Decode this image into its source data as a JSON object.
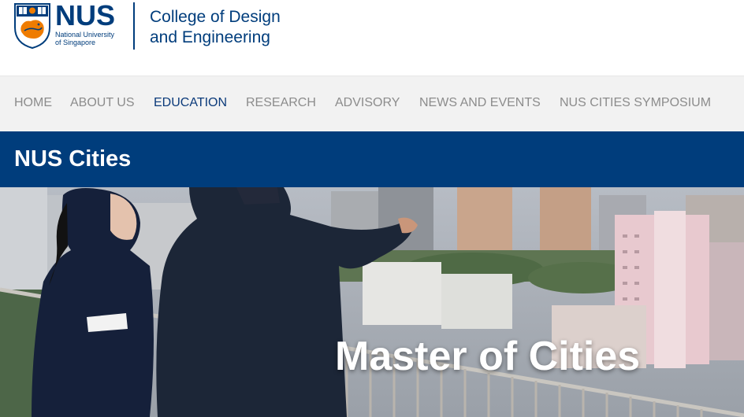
{
  "header": {
    "logo_wordmark": "NUS",
    "logo_subtext_line1": "National University",
    "logo_subtext_line2": "of Singapore",
    "college_line1": "College of Design",
    "college_line2": "and Engineering"
  },
  "nav": {
    "items": [
      {
        "label": "HOME",
        "active": false
      },
      {
        "label": "ABOUT US",
        "active": false
      },
      {
        "label": "EDUCATION",
        "active": true
      },
      {
        "label": "RESEARCH",
        "active": false
      },
      {
        "label": "ADVISORY",
        "active": false
      },
      {
        "label": "NEWS AND EVENTS",
        "active": false
      },
      {
        "label": "NUS CITIES SYMPOSIUM",
        "active": false
      }
    ]
  },
  "banner": {
    "title": "NUS Cities"
  },
  "hero": {
    "title": "Master of Cities",
    "image_icon": "hero-photo"
  },
  "colors": {
    "brand_blue": "#003d7c",
    "nav_bg": "#f2f2f2",
    "nav_text": "#8c8c8c",
    "nav_active": "#0b3a7a",
    "crest_orange": "#ef7c00"
  }
}
